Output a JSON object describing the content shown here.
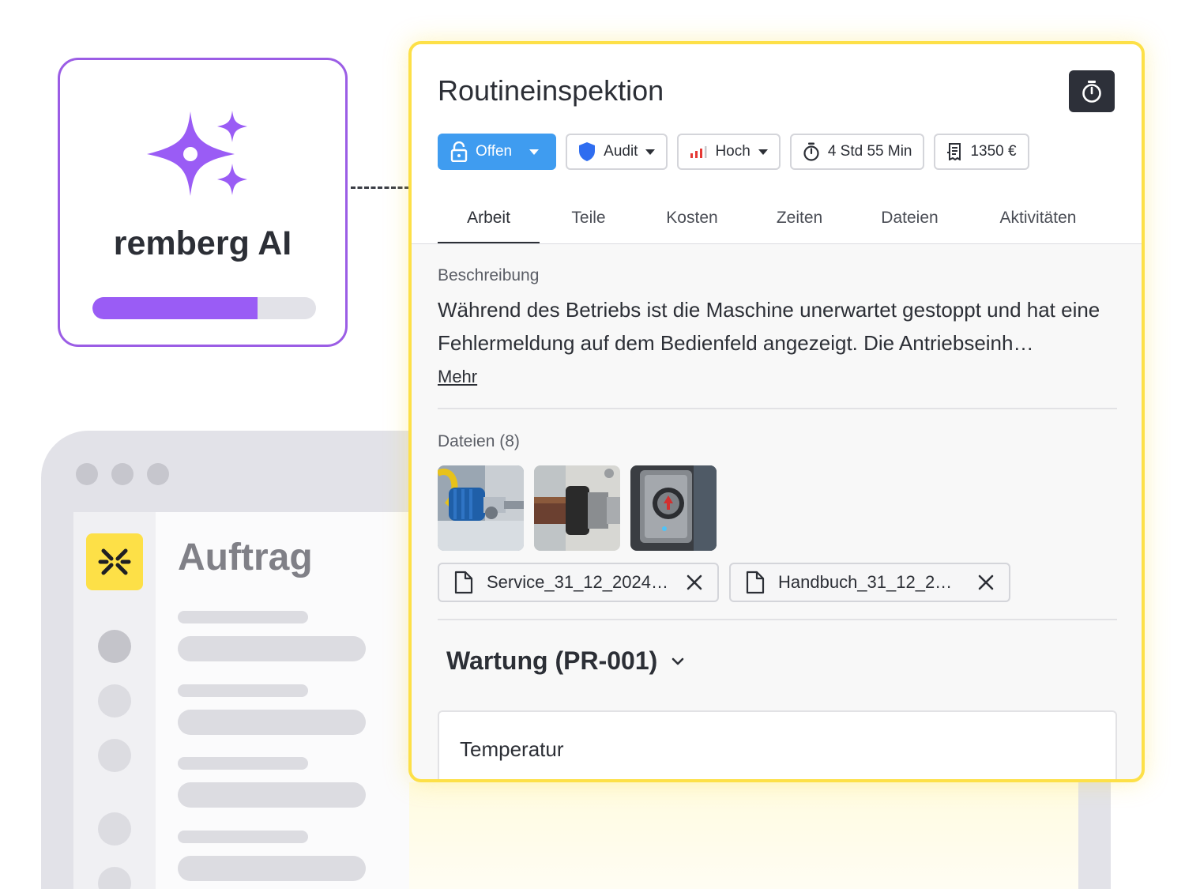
{
  "ai_card": {
    "label": "remberg AI",
    "progress": 0.74,
    "accent": "#9b5de5"
  },
  "background_app": {
    "title": "Auftrag",
    "logo_color": "#fde047"
  },
  "panel": {
    "title": "Routineinspektion",
    "timer_icon": "stopwatch-icon",
    "border_color": "#fde047",
    "chips": {
      "status": "Offen",
      "type": "Audit",
      "priority": "Hoch",
      "duration": "4 Std 55 Min",
      "cost": "1350 €"
    },
    "status_color": "#3f9cf0",
    "tabs": [
      "Arbeit",
      "Teile",
      "Kosten",
      "Zeiten",
      "Dateien",
      "Aktivitäten"
    ],
    "active_tab": "Arbeit",
    "description": {
      "label": "Beschreibung",
      "text": "Während des Betriebs ist die Maschine unerwartet gestoppt und hat eine Fehlermeldung auf dem Bedienfeld angezeigt. Die Antriebseinh…",
      "more": "Mehr"
    },
    "files": {
      "label": "Dateien (8)",
      "thumbnails": [
        "pump-motor-photo",
        "pipe-coupling-photo",
        "control-switch-photo"
      ],
      "attachments": [
        "Service_31_12_2024…",
        "Handbuch_31_12_2…"
      ]
    },
    "section": {
      "title": "Wartung (PR-001)",
      "field_label": "Temperatur"
    }
  }
}
